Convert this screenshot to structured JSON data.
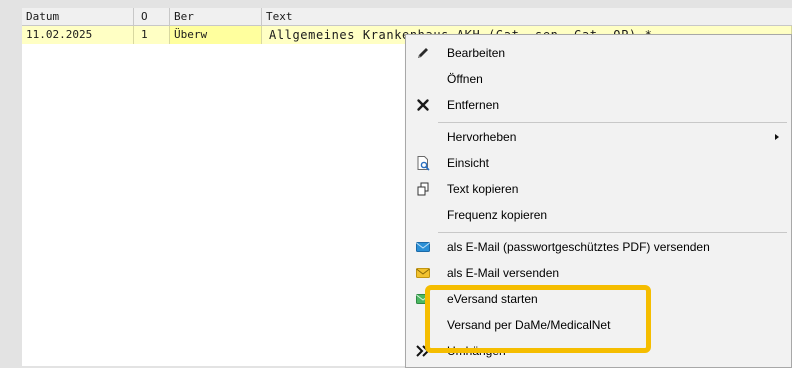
{
  "grid": {
    "headers": {
      "datum": "Datum",
      "o": "O",
      "ber": "Ber",
      "text": "Text"
    },
    "row": {
      "datum": "11.02.2025",
      "o": "1",
      "ber": "Überw",
      "text": "Allgemeines Krankenhaus AKH (Gat. sen.  Gat. OP) *"
    }
  },
  "context_menu": {
    "items": [
      {
        "label": "Bearbeiten",
        "icon": "pencil-icon"
      },
      {
        "label": "Öffnen",
        "icon": ""
      },
      {
        "label": "Entfernen",
        "icon": "close-icon"
      },
      {
        "label": "Hervorheben",
        "icon": "",
        "submenu": true
      },
      {
        "label": "Einsicht",
        "icon": "document-preview-icon"
      },
      {
        "label": "Text kopieren",
        "icon": "copy-icon"
      },
      {
        "label": "Frequenz kopieren",
        "icon": ""
      },
      {
        "label": "als E-Mail (passwortgeschütztes PDF) versenden",
        "icon": "email-blue-icon"
      },
      {
        "label": "als E-Mail versenden",
        "icon": "email-yellow-icon"
      },
      {
        "label": "eVersand starten",
        "icon": "email-green-icon"
      },
      {
        "label": "Versand per DaMe/MedicalNet",
        "icon": ""
      },
      {
        "label": "Umhängen",
        "icon": "double-chevron-right-icon"
      }
    ]
  },
  "colors": {
    "selected_row": "#ffffc4",
    "highlight_frame": "#f5bd00",
    "email_blue": "#2a8fd6",
    "email_yellow": "#f2c230",
    "email_green": "#4cb862"
  }
}
